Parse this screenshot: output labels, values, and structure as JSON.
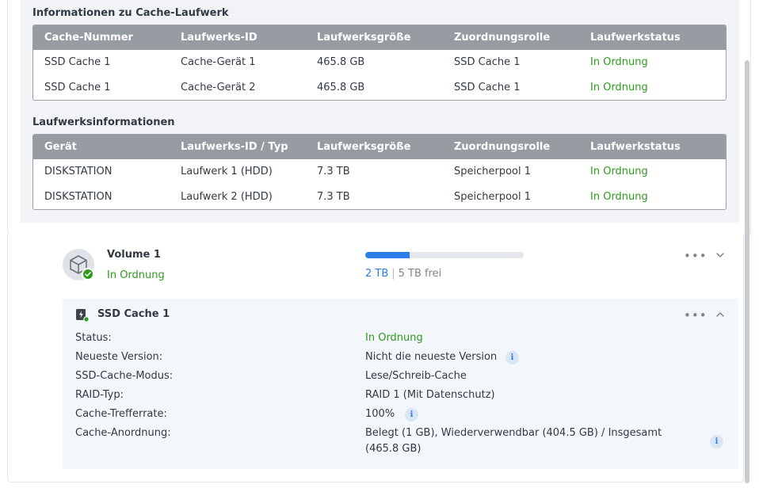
{
  "cache_drive_section": {
    "title": "Informationen zu Cache-Laufwerk",
    "headers": [
      "Cache-Nummer",
      "Laufwerks-ID",
      "Laufwerksgröße",
      "Zuordnungsrolle",
      "Laufwerkstatus"
    ],
    "rows": [
      [
        "SSD Cache 1",
        "Cache-Gerät 1",
        "465.8 GB",
        "SSD Cache 1",
        "In Ordnung"
      ],
      [
        "SSD Cache 1",
        "Cache-Gerät 2",
        "465.8 GB",
        "SSD Cache 1",
        "In Ordnung"
      ]
    ]
  },
  "drive_info_section": {
    "title": "Laufwerksinformationen",
    "headers": [
      "Gerät",
      "Laufwerks-ID / Typ",
      "Laufwerksgröße",
      "Zuordnungsrolle",
      "Laufwerkstatus"
    ],
    "rows": [
      [
        "DISKSTATION",
        "Laufwerk 1 (HDD)",
        "7.3 TB",
        "Speicherpool 1",
        "In Ordnung"
      ],
      [
        "DISKSTATION",
        "Laufwerk 2 (HDD)",
        "7.3 TB",
        "Speicherpool 1",
        "In Ordnung"
      ]
    ]
  },
  "volume": {
    "name": "Volume 1",
    "status": "In Ordnung",
    "used": "2 TB",
    "free": "5 TB frei",
    "used_fraction": 0.28,
    "icon": "cube-icon"
  },
  "ssd_cache": {
    "title": "SSD Cache 1",
    "icon": "ssd-cache-icon",
    "properties": [
      {
        "label": "Status:",
        "value": "In Ordnung"
      },
      {
        "label": "Neueste Version:",
        "value": "Nicht die neueste Version"
      },
      {
        "label": "SSD-Cache-Modus:",
        "value": "Lese/Schreib-Cache"
      },
      {
        "label": "RAID-Typ:",
        "value": "RAID 1 (Mit Datenschutz)"
      },
      {
        "label": "Cache-Trefferrate:",
        "value": "100%"
      },
      {
        "label": "Cache-Anordnung:",
        "value": "Belegt (1 GB), Wiederverwendbar (404.5 GB) / Insgesamt",
        "value_line2": "(465.8 GB)"
      }
    ]
  },
  "colors": {
    "ok_green": "#2e9a1c",
    "accent_blue": "#2b7de9",
    "table_header": "#979ba2"
  },
  "more_label": "•••"
}
